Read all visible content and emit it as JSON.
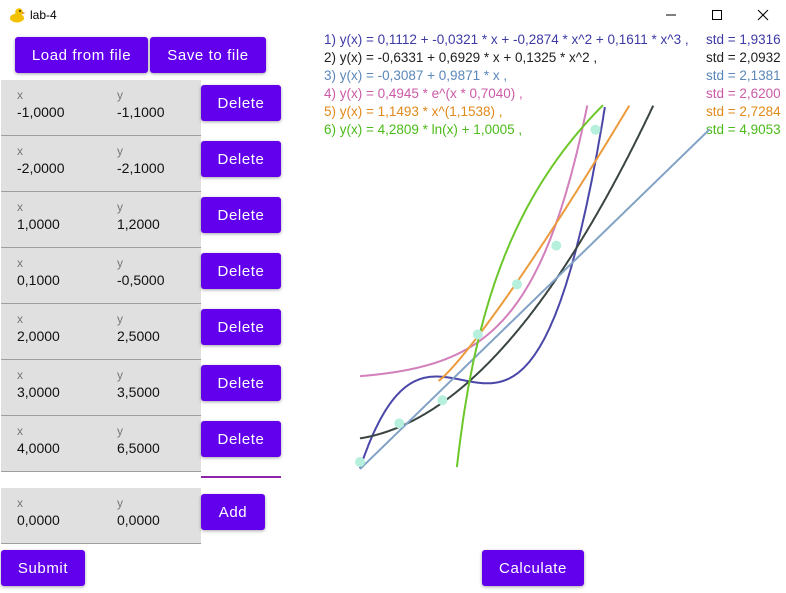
{
  "window": {
    "title": "lab-4"
  },
  "toolbar": {
    "load_label": "Load from file",
    "save_label": "Save to file"
  },
  "points": [
    {
      "x_label": "x",
      "y_label": "y",
      "x": "-1,0000",
      "y": "-1,1000",
      "delete_label": "Delete"
    },
    {
      "x_label": "x",
      "y_label": "y",
      "x": "-2,0000",
      "y": "-2,1000",
      "delete_label": "Delete"
    },
    {
      "x_label": "x",
      "y_label": "y",
      "x": "1,0000",
      "y": "1,2000",
      "delete_label": "Delete"
    },
    {
      "x_label": "x",
      "y_label": "y",
      "x": "0,1000",
      "y": "-0,5000",
      "delete_label": "Delete"
    },
    {
      "x_label": "x",
      "y_label": "y",
      "x": "2,0000",
      "y": "2,5000",
      "delete_label": "Delete"
    },
    {
      "x_label": "x",
      "y_label": "y",
      "x": "3,0000",
      "y": "3,5000",
      "delete_label": "Delete"
    },
    {
      "x_label": "x",
      "y_label": "y",
      "x": "4,0000",
      "y": "6,5000",
      "delete_label": "Delete"
    }
  ],
  "new_point": {
    "x_label": "x",
    "y_label": "y",
    "x": "0,0000",
    "y": "0,0000",
    "add_label": "Add"
  },
  "actions": {
    "submit_label": "Submit",
    "calculate_label": "Calculate"
  },
  "equations": [
    {
      "text": "1) y(x) = 0,1112 + -0,0321 * x + -0,2874 * x^2 + 0,1611 * x^3 ,",
      "std": "std = 1,9316",
      "color": "#3d3aa5"
    },
    {
      "text": "2) y(x) = -0,6331 + 0,6929 * x + 0,1325 * x^2 ,",
      "std": "std = 2,0932",
      "color": "#222222"
    },
    {
      "text": "3) y(x) = -0,3087 + 0,9871 * x ,",
      "std": "std = 2,1381",
      "color": "#5b87b8"
    },
    {
      "text": "4) y(x) = 0,4945 * e^(x * 0,7040) ,",
      "std": "std = 2,6200",
      "color": "#cc5aa6"
    },
    {
      "text": "5) y(x) = 1,1493 * x^(1,1538) ,",
      "std": "std = 2,7284",
      "color": "#e08a1b"
    },
    {
      "text": "6) y(x) = 4,2809 * ln(x) + 1,0005 ,",
      "std": "std = 4,9053",
      "color": "#4bbb18"
    }
  ],
  "chart_data": {
    "type": "scatter",
    "points": [
      [
        -1,
        -1.1
      ],
      [
        -2,
        -2.1
      ],
      [
        1,
        1.2
      ],
      [
        0.1,
        -0.5
      ],
      [
        2,
        2.5
      ],
      [
        3,
        3.5
      ],
      [
        4,
        6.5
      ]
    ],
    "point_color": "#b6f0dc",
    "series": [
      {
        "a": [
          0.1112,
          -0.0321,
          -0.2874,
          0.1611
        ],
        "kind": "poly",
        "color": "#4a47a8"
      },
      {
        "a": [
          -0.6331,
          0.6929,
          0.1325
        ],
        "kind": "poly",
        "color": "#3a4542"
      },
      {
        "a": [
          -0.3087,
          0.9871
        ],
        "kind": "poly",
        "color": "#82a2c6"
      },
      {
        "a": [
          0.4945,
          0.704
        ],
        "kind": "exp",
        "color": "#d27fbb"
      },
      {
        "a": [
          1.1493,
          1.1538
        ],
        "kind": "power",
        "color": "#eb9b3c"
      },
      {
        "a": [
          4.2809,
          1.0005
        ],
        "kind": "log",
        "color": "#6cc82a"
      }
    ]
  }
}
